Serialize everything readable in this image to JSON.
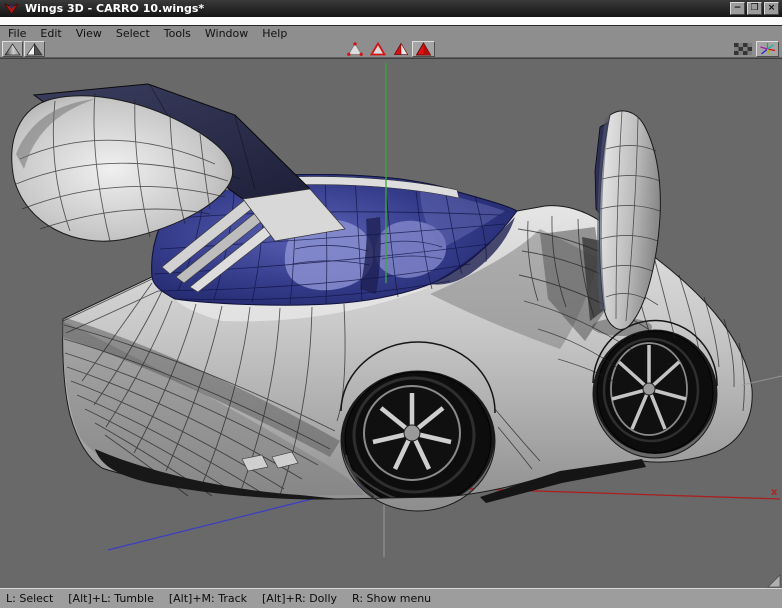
{
  "window": {
    "title": "Wings 3D - CARRO 10.wings*",
    "controls": {
      "minimize": "−",
      "restore": "❒",
      "close": "×"
    }
  },
  "menu": {
    "items": [
      "File",
      "Edit",
      "View",
      "Select",
      "Tools",
      "Window",
      "Help"
    ]
  },
  "toolbar": {
    "left_icons": [
      {
        "name": "shaded-view-icon"
      },
      {
        "name": "flat-view-icon"
      }
    ],
    "selection_modes": [
      {
        "name": "vertex-mode-icon",
        "active": false
      },
      {
        "name": "edge-mode-icon",
        "active": false
      },
      {
        "name": "face-mode-icon",
        "active": false
      },
      {
        "name": "body-mode-icon",
        "active": true
      }
    ],
    "right_icons": [
      {
        "name": "ground-plane-icon",
        "active": false
      },
      {
        "name": "axes-icon",
        "active": true
      }
    ]
  },
  "viewport": {
    "axis_label_x": "x",
    "colors": {
      "background": "#696969",
      "axis_x": "#aa2020",
      "axis_y": "#3aa83a",
      "axis_z": "#3c3cc8",
      "axis_negative": "#9b9b9b",
      "glass": "#343a86",
      "body": "#c9c9c9"
    }
  },
  "statusbar": {
    "segments": [
      "L: Select",
      "[Alt]+L: Tumble",
      "[Alt]+M: Track",
      "[Alt]+R: Dolly",
      "R: Show menu"
    ]
  }
}
